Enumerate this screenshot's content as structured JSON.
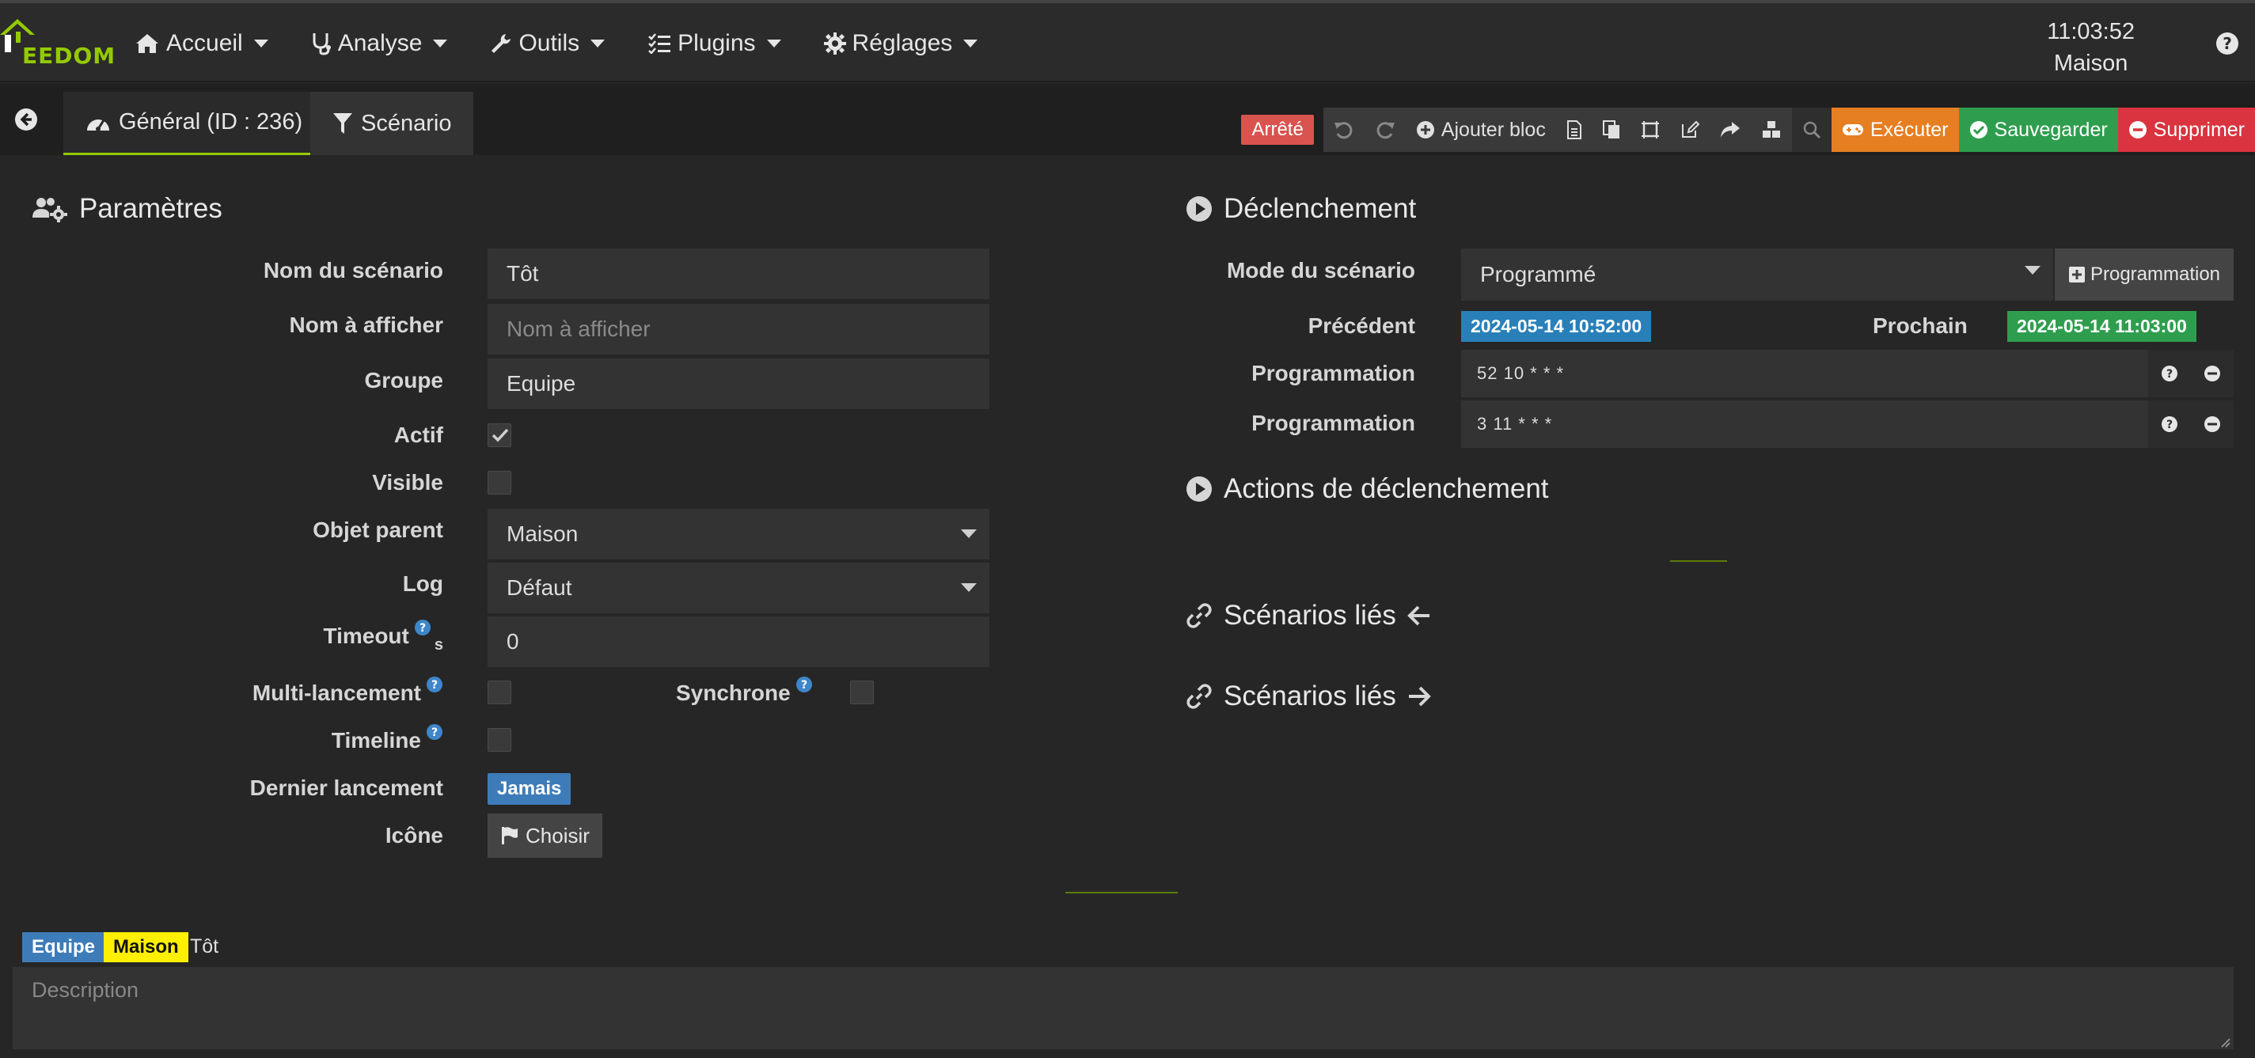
{
  "navbar": {
    "logo_text": "EEDOM",
    "menu": [
      {
        "label": "Accueil",
        "icon": "home-icon"
      },
      {
        "label": "Analyse",
        "icon": "stethoscope-icon"
      },
      {
        "label": "Outils",
        "icon": "wrench-icon"
      },
      {
        "label": "Plugins",
        "icon": "tasks-icon"
      },
      {
        "label": "Réglages",
        "icon": "gear-icon"
      }
    ],
    "time": "11:03:52",
    "location": "Maison"
  },
  "tabs": {
    "general": "Général (ID : 236)",
    "scenario": "Scénario"
  },
  "toolbar": {
    "status": "Arrêté",
    "add_block": "Ajouter bloc",
    "execute": "Exécuter",
    "save": "Sauvegarder",
    "delete": "Supprimer"
  },
  "params": {
    "title": "Paramètres",
    "name_label": "Nom du scénario",
    "name_value": "Tôt",
    "display_label": "Nom à afficher",
    "display_placeholder": "Nom à afficher",
    "group_label": "Groupe",
    "group_value": "Equipe",
    "active_label": "Actif",
    "active_checked": true,
    "visible_label": "Visible",
    "visible_checked": false,
    "parent_label": "Objet parent",
    "parent_value": "Maison",
    "log_label": "Log",
    "log_value": "Défaut",
    "timeout_label": "Timeout",
    "timeout_unit": "s",
    "timeout_value": "0",
    "multi_label": "Multi-lancement",
    "sync_label": "Synchrone",
    "timeline_label": "Timeline",
    "last_run_label": "Dernier lancement",
    "last_run_value": "Jamais",
    "icon_label": "Icône",
    "choose_label": "Choisir"
  },
  "trigger": {
    "title": "Déclenchement",
    "mode_label": "Mode du scénario",
    "mode_value": "Programmé",
    "programming_button": "Programmation",
    "previous_label": "Précédent",
    "previous_value": "2024-05-14 10:52:00",
    "next_label": "Prochain",
    "next_value": "2024-05-14 11:03:00",
    "schedules": [
      {
        "label": "Programmation",
        "value": "52 10 * * *"
      },
      {
        "label": "Programmation",
        "value": "3 11 * * *"
      }
    ],
    "actions_title": "Actions de déclenchement",
    "linked_in_title": "Scénarios liés",
    "linked_out_title": "Scénarios liés"
  },
  "footer": {
    "tag_group": "Equipe",
    "tag_object": "Maison",
    "scenario_name": "Tôt",
    "description_placeholder": "Description"
  },
  "colors": {
    "accent": "#94ca02",
    "status_stopped": "#d9534f",
    "execute": "#e67e22",
    "save": "#2e9e4e",
    "delete": "#d9343f",
    "badge_blue": "#3e7cb9",
    "date_previous": "#2980b9",
    "date_next": "#2e9e4e",
    "tag_object": "#ffef00"
  }
}
